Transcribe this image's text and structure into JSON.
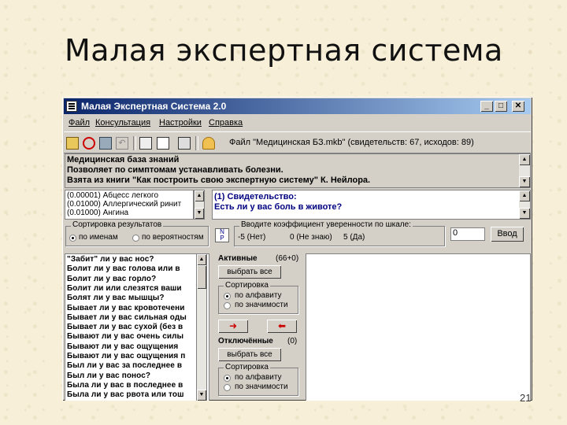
{
  "slide": {
    "title": "Малая экспертная система",
    "page_number": "21"
  },
  "window": {
    "title": "Малая Экспертная Система 2.0",
    "min": "_",
    "max": "□",
    "close": "✕"
  },
  "menu": [
    "Файл",
    "Консультация",
    "Настройки",
    "Справка"
  ],
  "toolbar": {
    "file_info": "Файл \"Медицинская БЗ.mkb\" (свидетельств: 67, исходов: 89)",
    "icons": [
      "open-icon",
      "stop-icon",
      "edit-icon",
      "undo-icon",
      "calculator-icon",
      "notes-icon",
      "chart-icon",
      "user-icon"
    ]
  },
  "kb_info": {
    "line1": "Медицинская база знаний",
    "line2": "Позволяет по симптомам устанавливать болезни.",
    "line3": "Взята из книги \"Как построить свою экспертную систему\" К. Нейлора."
  },
  "outcomes": [
    "(0.00001) Абцесс легкого",
    "(0.01000) Аллергический ринит",
    "(0.01000) Ангина"
  ],
  "evidence": {
    "label": "(1) Свидетельство:",
    "question": "Есть ли у вас боль в животе?"
  },
  "sorting_results": {
    "title": "Сортировка результатов",
    "opt1": "по именам",
    "opt2": "по вероятностям"
  },
  "confidence": {
    "title": "Вводите коэффициент уверенности по шкале:",
    "min": "-5 (Нет)",
    "mid": "0 (Не знаю)",
    "max": "5 (Да)",
    "value": "0",
    "enter": "Ввод"
  },
  "questions": [
    "\"Забит\" ли у вас нос?",
    "Болит ли у вас голова или в",
    "Болит ли у вас горло?",
    "Болит ли или слезятся ваши",
    "Болят ли у вас мышцы?",
    "Бывает ли у вас кровотечени",
    "Бывает ли у вас сильная оды",
    "Бывает ли у вас сухой (без в",
    "Бывают ли у вас очень силы",
    "Бывают ли у вас ощущения ",
    "Бывают ли у вас ощущения п",
    "Был ли у вас за последнее в",
    "Был ли у вас понос?",
    "Была ли у вас в последнее в",
    "Была ли у вас рвота или тош"
  ],
  "active": {
    "title": "Активные",
    "count": "(66+0)",
    "select_all": "выбрать все",
    "sort_title": "Сортировка",
    "opt1": "по алфавиту",
    "opt2": "по значимости"
  },
  "arrows": {
    "right": "➜",
    "left": "⬅"
  },
  "disabled": {
    "title": "Отключённые",
    "count": "(0)",
    "select_all": "выбрать все",
    "sort_title": "Сортировка",
    "opt1": "по алфавиту",
    "opt2": "по значимости"
  }
}
